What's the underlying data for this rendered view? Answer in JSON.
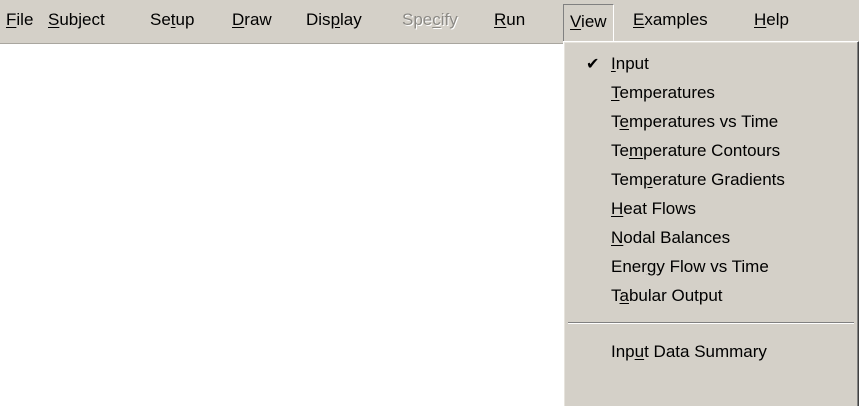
{
  "menubar": {
    "items": [
      {
        "pre": "",
        "key": "F",
        "post": "ile"
      },
      {
        "pre": "",
        "key": "S",
        "post": "ubject"
      },
      {
        "pre": "Se",
        "key": "t",
        "post": "up"
      },
      {
        "pre": "",
        "key": "D",
        "post": "raw"
      },
      {
        "pre": "Dis",
        "key": "p",
        "post": "lay"
      },
      {
        "pre": "Spe",
        "key": "c",
        "post": "ify"
      },
      {
        "pre": "",
        "key": "R",
        "post": "un"
      },
      {
        "pre": "",
        "key": "V",
        "post": "iew"
      },
      {
        "pre": "",
        "key": "E",
        "post": "xamples"
      },
      {
        "pre": "",
        "key": "H",
        "post": "elp"
      }
    ],
    "disabled_item": "Specify",
    "open_item": "View"
  },
  "view_menu": {
    "check_glyph": "✔",
    "items": [
      {
        "pre": "",
        "key": "I",
        "post": "nput",
        "checked": true
      },
      {
        "pre": "",
        "key": "T",
        "post": "emperatures",
        "checked": false
      },
      {
        "pre": "T",
        "key": "e",
        "post": "mperatures vs Time",
        "checked": false
      },
      {
        "pre": "Te",
        "key": "m",
        "post": "perature Contours",
        "checked": false
      },
      {
        "pre": "Tem",
        "key": "p",
        "post": "erature Gradients",
        "checked": false
      },
      {
        "pre": "",
        "key": "H",
        "post": "eat Flows",
        "checked": false
      },
      {
        "pre": "",
        "key": "N",
        "post": "odal Balances",
        "checked": false
      },
      {
        "pre": "Ener",
        "key": "g",
        "post": "y Flow vs Time",
        "checked": false
      },
      {
        "pre": "T",
        "key": "a",
        "post": "bular Output",
        "checked": false
      },
      {
        "pre": "Inp",
        "key": "u",
        "post": "t Data Summary",
        "checked": false
      }
    ]
  },
  "colors": {
    "menu_face": "#d4d0c8",
    "disabled_text": "#8c8a85",
    "workspace": "#ffffff"
  }
}
